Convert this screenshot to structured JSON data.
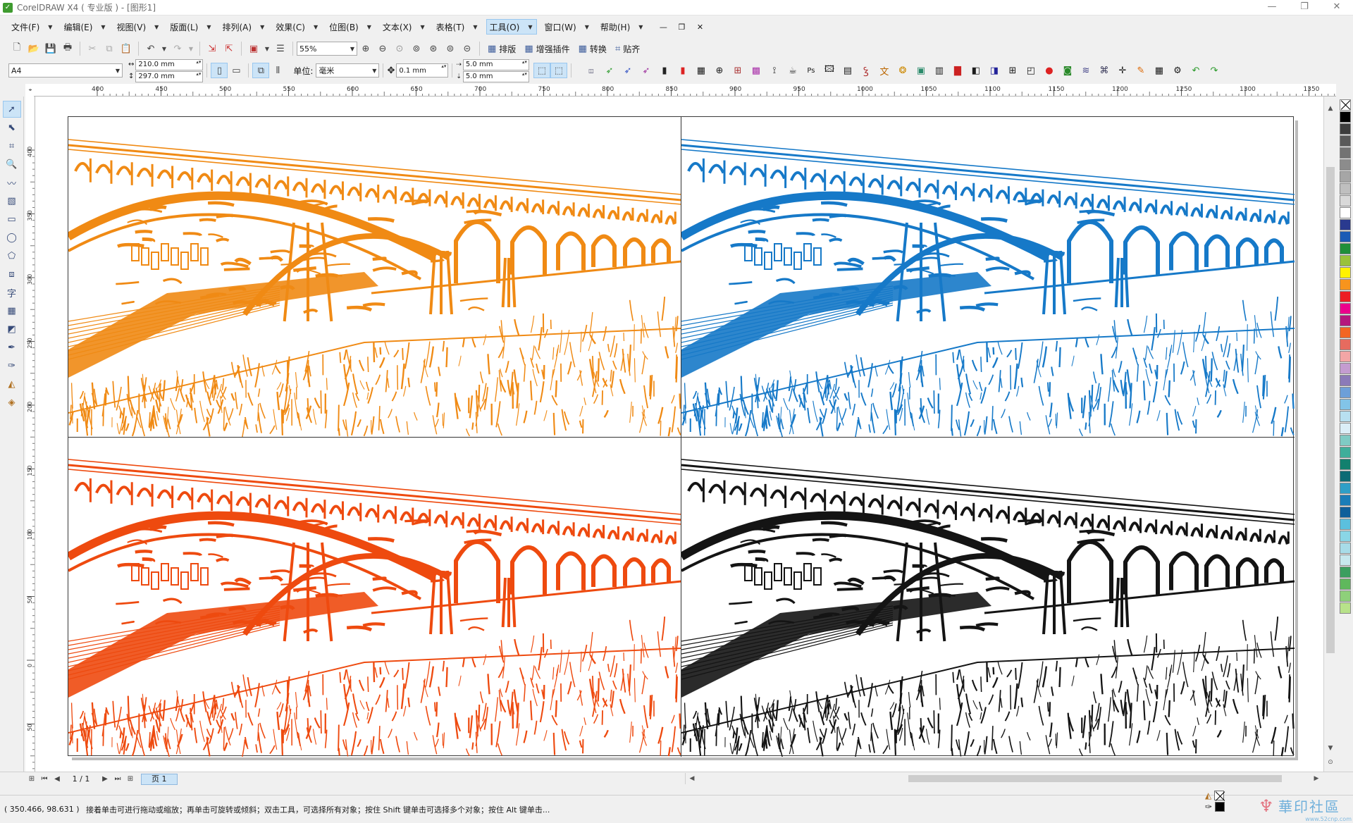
{
  "window": {
    "title": "CorelDRAW X4 ( 专业版 ) - [图形1]",
    "controls": [
      "—",
      "❐",
      "✕"
    ]
  },
  "menu": {
    "items": [
      {
        "label": "文件(F)"
      },
      {
        "label": "编辑(E)"
      },
      {
        "label": "视图(V)"
      },
      {
        "label": "版面(L)"
      },
      {
        "label": "排列(A)"
      },
      {
        "label": "效果(C)"
      },
      {
        "label": "位图(B)"
      },
      {
        "label": "文本(X)"
      },
      {
        "label": "表格(T)"
      },
      {
        "label": "工具(O)",
        "active": true
      },
      {
        "label": "窗口(W)"
      },
      {
        "label": "帮助(H)"
      }
    ],
    "doc_controls": [
      "—",
      "❐",
      "✕"
    ]
  },
  "standard_toolbar": {
    "zoom_level": "55%",
    "buttons": {
      "layout": "排版",
      "plugins": "增强插件",
      "convert": "转换",
      "snap": "贴齐"
    }
  },
  "property_bar": {
    "paper_size": "A4",
    "width": "210.0 mm",
    "height": "297.0 mm",
    "unit_label": "单位:",
    "unit": "毫米",
    "nudge": "0.1 mm",
    "dup_x": "5.0 mm",
    "dup_y": "5.0 mm"
  },
  "rulers": {
    "top_ticks": [
      "400",
      "450",
      "500",
      "550",
      "600",
      "650",
      "700",
      "750",
      "800",
      "850",
      "900",
      "950",
      "1000",
      "1050",
      "1100",
      "1150",
      "1200",
      "1250",
      "1300",
      "1350"
    ],
    "left_ticks": [
      "400",
      "350",
      "300",
      "250",
      "200",
      "150",
      "100",
      "50",
      "0",
      "50"
    ]
  },
  "artwork": {
    "quadrants": [
      {
        "name": "orange",
        "color": "#f08a14"
      },
      {
        "name": "blue",
        "color": "#1679c8"
      },
      {
        "name": "red",
        "color": "#ee4a0f"
      },
      {
        "name": "black",
        "color": "#141414"
      }
    ]
  },
  "palette": {
    "colors": [
      "#000000",
      "#3d3d3d",
      "#595959",
      "#737373",
      "#8c8c8c",
      "#a6a6a6",
      "#bfbfbf",
      "#d9d9d9",
      "#ffffff",
      "#2a3a8f",
      "#1b5bb5",
      "#1f8f3a",
      "#9ac23a",
      "#fff200",
      "#f7941d",
      "#ed1c24",
      "#ec008c",
      "#b5177d",
      "#f26522",
      "#e66b5f",
      "#f3a6a6",
      "#c49cd0",
      "#8b7ab8",
      "#6d9fd8",
      "#82c4e8",
      "#b8e0f0",
      "#dbeef7",
      "#7fcbc4",
      "#3fae9a",
      "#12806e",
      "#0c6b75",
      "#2e9fc7",
      "#1a7db8",
      "#0f5f9a",
      "#5bc0de",
      "#8ad6e6",
      "#a8dce8",
      "#c7e8ee",
      "#3b9e5f",
      "#5fb85c",
      "#8ed07a",
      "#b8e28a"
    ]
  },
  "page_nav": {
    "count": "1 / 1",
    "tab": "页 1"
  },
  "status": {
    "coords": "( 350.466, 98.631 )",
    "hint": "接着单击可进行拖动或缩放；再单击可旋转或倾斜；双击工具，可选择所有对象；按住 Shift 键单击可选择多个对象；按住 Alt 键单击..."
  },
  "watermark": {
    "text": "華印社區",
    "url": "www.52cnp.com"
  }
}
